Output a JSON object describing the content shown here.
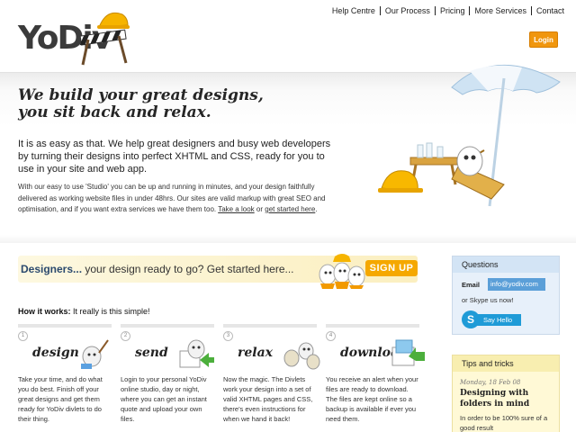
{
  "brand": {
    "logo_text": "YoDiv"
  },
  "nav": {
    "items": [
      "Help Centre",
      "Our Process",
      "Pricing",
      "More Services",
      "Contact"
    ],
    "login_label": "Login"
  },
  "hero": {
    "title_line1": "We build your great designs,",
    "title_line2": "you sit back and relax.",
    "lead": "It is as easy as that. We help great designers and busy web developers by turning their designs into perfect XHTML and CSS, ready for you to use in your site and web app.",
    "small_text": "With our easy to use 'Studio' you can be up and running in minutes, and your design faithfully delivered as working website files in under 48hrs. Our sites are valid markup with great SEO and optimisation, and if you want extra services we have them too.",
    "link_take_look": "Take a look",
    "link_or": "or",
    "link_get_started": "get started here",
    "link_end": "."
  },
  "signup": {
    "designers_label": "Designers...",
    "prompt": "your design ready to go? Get started here...",
    "button_label": "SIGN UP"
  },
  "how": {
    "title_bold": "How it works:",
    "title_rest": "It really is this simple!",
    "steps": [
      {
        "num": "1",
        "word": "design",
        "text": "Take your time, and do what you do best. Finish off your great designs and get them ready for YoDiv divlets to do their thing."
      },
      {
        "num": "2",
        "word": "send",
        "text": "Login to your personal YoDiv online studio, day or night, where you can get an instant quote and upload your own files."
      },
      {
        "num": "3",
        "word": "relax",
        "text": "Now the magic. The Divlets work your design into a set of valid XHTML pages and CSS, there's even instructions for when we hand it back!"
      },
      {
        "num": "4",
        "word": "download",
        "text": "You receive an alert when your files are ready to download. The files are kept online so a backup is available if ever you need them."
      }
    ]
  },
  "questions": {
    "title": "Questions",
    "email_label": "Email",
    "email_value": "info@yodiv.com",
    "skype_text": "or Skype us now!",
    "say_hello": "Say Hello"
  },
  "tips": {
    "title": "Tips and tricks",
    "date": "Monday, 18 Feb 08",
    "headline": "Designing with folders in mind",
    "text": "In order to be 100% sure of a good result"
  },
  "colors": {
    "accent_orange": "#f0960e",
    "signup_yellow": "#f5a800",
    "skype_blue": "#1f9bd7",
    "questions_bg": "#e7f0fa",
    "tips_bg": "#fff9d6"
  }
}
